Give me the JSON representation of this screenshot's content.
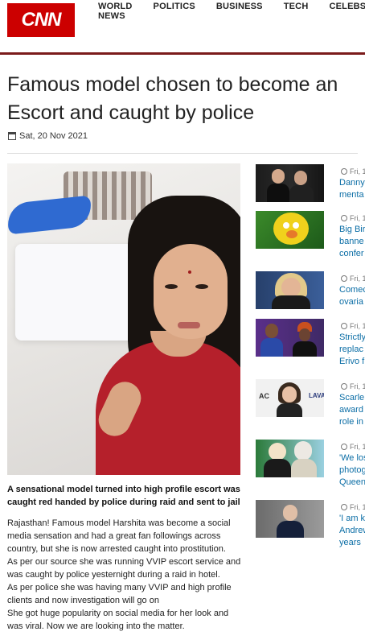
{
  "brand": {
    "logo_text": "CNN",
    "color": "#cc0000"
  },
  "nav": [
    {
      "label": "WORLD NEWS"
    },
    {
      "label": "POLITICS"
    },
    {
      "label": "BUSINESS"
    },
    {
      "label": "TECH"
    },
    {
      "label": "CELEBS"
    }
  ],
  "article": {
    "title": "Famous model chosen to become an Escort and caught by police",
    "date": "Sat, 20 Nov 2021",
    "caption": "A sensational model turned into high profile escort was caught red handed by police during raid and sent to jail",
    "paragraphs": [
      "Rajasthan! Famous model Harshita was become a social media sensation and had a great fan followings across country, but she is now arrested caught into prostitution.",
      "As per our source she was running VVIP escort service and was caught by police yesternight during a raid in hotel.",
      "As per police she was having many VVIP and high profile clients and now investigation will go on",
      "She got huge popularity on social media for her look and was viral. Now we are looking into the matter."
    ]
  },
  "sidebar": [
    {
      "date": "Fri, 1",
      "lines": [
        "Danny",
        "menta"
      ]
    },
    {
      "date": "Fri, 1",
      "lines": [
        "Big Bir",
        "banne",
        "confer"
      ]
    },
    {
      "date": "Fri, 1",
      "lines": [
        "Comec",
        "ovariа"
      ]
    },
    {
      "date": "Fri, 1",
      "lines": [
        "Strictly",
        "replac",
        "Erivo f"
      ]
    },
    {
      "date": "Fri, 1",
      "lines": [
        "Scarle",
        "award",
        "role in"
      ]
    },
    {
      "date": "Fri, 1",
      "lines": [
        "'We los",
        "photog",
        "Queen"
      ]
    },
    {
      "date": "Fri, 1",
      "lines": [
        "'I am k",
        "Andrew",
        "years"
      ]
    }
  ],
  "colors": {
    "accent_red": "#cc0000",
    "divider_dark_red": "#7a1b1b",
    "link_blue": "#0c6ea6"
  }
}
